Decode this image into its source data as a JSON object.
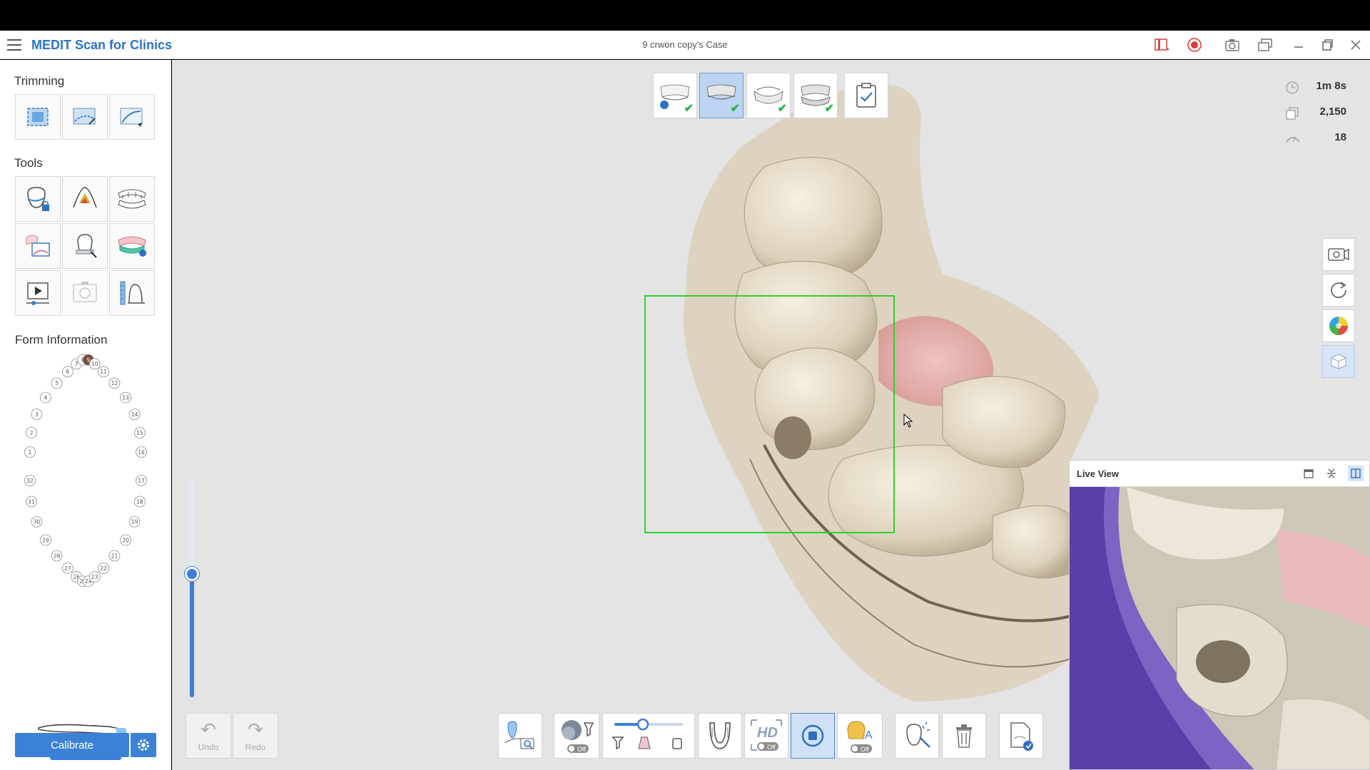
{
  "app": {
    "title": "MEDIT Scan for Clinics",
    "case_title": "9 crwon copy's Case"
  },
  "titlebar_icons": [
    "scan-layout-icon",
    "record-icon",
    "camera-icon",
    "windows-icon",
    "minimize-icon",
    "maximize-icon",
    "close-icon"
  ],
  "sidebar": {
    "trimming_title": "Trimming",
    "trimming_tools": [
      "trim-box-icon",
      "trim-lasso-icon",
      "trim-brush-icon"
    ],
    "tools_title": "Tools",
    "tools": [
      "lock-tooth-icon",
      "color-margin-icon",
      "jaw-align-icon",
      "smart-color-icon",
      "tooth-tip-icon",
      "full-arch-icon",
      "play-video-icon",
      "photo-icon",
      "measure-icon"
    ],
    "form_title": "Form Information",
    "upper_teeth": [
      "1",
      "2",
      "3",
      "4",
      "5",
      "6",
      "7",
      "8",
      "9",
      "10",
      "11",
      "12",
      "13",
      "14",
      "15",
      "16"
    ],
    "lower_teeth": [
      "17",
      "18",
      "19",
      "20",
      "21",
      "22",
      "23",
      "24",
      "25",
      "26",
      "27",
      "28",
      "29",
      "30",
      "31",
      "32"
    ],
    "selected_tooth": "9",
    "calibrate_label": "Calibrate",
    "scan_depth_level": 0.55
  },
  "stages": [
    {
      "name": "maxilla-stage",
      "done": true,
      "active": false
    },
    {
      "name": "mandible-stage",
      "done": true,
      "active": true
    },
    {
      "name": "occlusion-stage-1",
      "done": true,
      "active": false
    },
    {
      "name": "occlusion-stage-2",
      "done": true,
      "active": false
    },
    {
      "name": "review-stage",
      "done": false,
      "active": false
    }
  ],
  "stats": {
    "time": "1m 8s",
    "shots": "2,150",
    "count": "18"
  },
  "right_tools": [
    "video-camera-icon",
    "rotate-icon",
    "color-wheel-icon",
    "texture-cube-icon"
  ],
  "bottom": {
    "undo_label": "Undo",
    "redo_label": "Redo",
    "off_label": "Off",
    "hd_label": "HD",
    "filter_level": 0.4
  },
  "live_view": {
    "title": "Live View"
  },
  "colors": {
    "accent": "#3b82d6",
    "selection": "#2fd02f",
    "check": "#27b14a"
  }
}
